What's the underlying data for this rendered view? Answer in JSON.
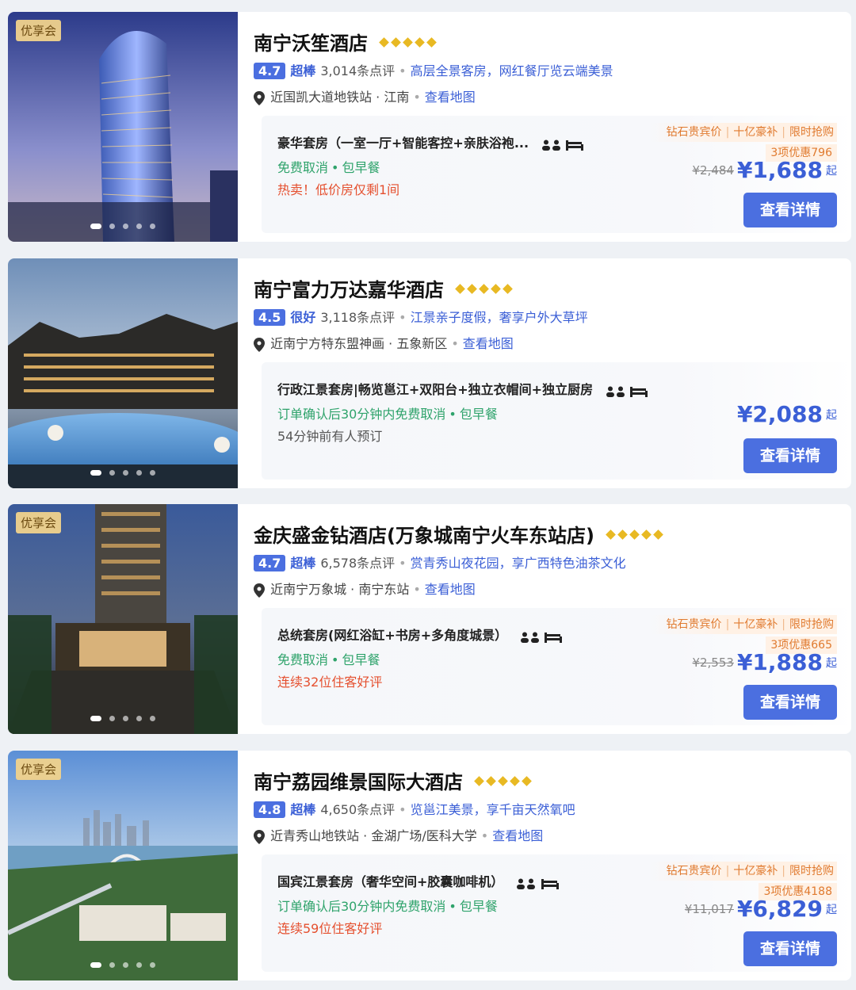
{
  "hotels": [
    {
      "badge": "优享会",
      "name": "南宁沃笙酒店",
      "score": "4.7",
      "score_label": "超棒",
      "reviews": "3,014条点评",
      "blurb": "高层全景客房，网红餐厅览云端美景",
      "location": "近国凯大道地铁站 · 江南",
      "map_link": "查看地图",
      "room_name": "豪华套房（一室一厅+智能客控+亲肤浴袍...",
      "perks": [
        "免费取消",
        "包早餐"
      ],
      "note": "热卖！低价房仅剩1间",
      "note_style": "red",
      "promo_tags": [
        "钻石贵宾价",
        "十亿豪补",
        "限时抢购"
      ],
      "promo_discount": "3项优惠796",
      "old_price": "¥2,484",
      "price": "¥1,688",
      "price_suffix": "起",
      "button": "查看详情"
    },
    {
      "badge": "",
      "name": "南宁富力万达嘉华酒店",
      "score": "4.5",
      "score_label": "很好",
      "reviews": "3,118条点评",
      "blurb": "江景亲子度假，奢享户外大草坪",
      "location": "近南宁方特东盟神画 · 五象新区",
      "map_link": "查看地图",
      "room_name": "行政江景套房|畅览邕江+双阳台+独立衣帽间+独立厨房",
      "perks": [
        "订单确认后30分钟内免费取消",
        "包早餐"
      ],
      "note": "54分钟前有人预订",
      "note_style": "gray",
      "promo_tags": [],
      "promo_discount": "",
      "old_price": "",
      "price": "¥2,088",
      "price_suffix": "起",
      "button": "查看详情"
    },
    {
      "badge": "优享会",
      "name": "金庆盛金钻酒店(万象城南宁火车东站店)",
      "score": "4.7",
      "score_label": "超棒",
      "reviews": "6,578条点评",
      "blurb": "赏青秀山夜花园，享广西特色油茶文化",
      "location": "近南宁万象城 · 南宁东站",
      "map_link": "查看地图",
      "room_name": "总统套房(网红浴缸+书房+多角度城景）",
      "perks": [
        "免费取消",
        "包早餐"
      ],
      "note": "连续32位住客好评",
      "note_style": "red",
      "promo_tags": [
        "钻石贵宾价",
        "十亿豪补",
        "限时抢购"
      ],
      "promo_discount": "3项优惠665",
      "old_price": "¥2,553",
      "price": "¥1,888",
      "price_suffix": "起",
      "button": "查看详情"
    },
    {
      "badge": "优享会",
      "name": "南宁荔园维景国际大酒店",
      "score": "4.8",
      "score_label": "超棒",
      "reviews": "4,650条点评",
      "blurb": "览邕江美景，享千亩天然氧吧",
      "location": "近青秀山地铁站 · 金湖广场/医科大学",
      "map_link": "查看地图",
      "room_name": "国宾江景套房（奢华空间+胶囊咖啡机）",
      "perks": [
        "订单确认后30分钟内免费取消",
        "包早餐"
      ],
      "note": "连续59位住客好评",
      "note_style": "red",
      "promo_tags": [
        "钻石贵宾价",
        "十亿豪补",
        "限时抢购"
      ],
      "promo_discount": "3项优惠4188",
      "old_price": "¥11,017",
      "price": "¥6,829",
      "price_suffix": "起",
      "button": "查看详情"
    }
  ],
  "icons": {
    "rating": "diamond-icon",
    "location": "pin-icon",
    "occupancy": "person-icon",
    "bed": "bed-icon"
  },
  "colors": {
    "accent": "#4b6fe0",
    "link": "#3b5fd6",
    "perk": "#2fa36b",
    "alert": "#e5502f",
    "promo": "#e07a2f",
    "diamond": "#e8b923"
  }
}
